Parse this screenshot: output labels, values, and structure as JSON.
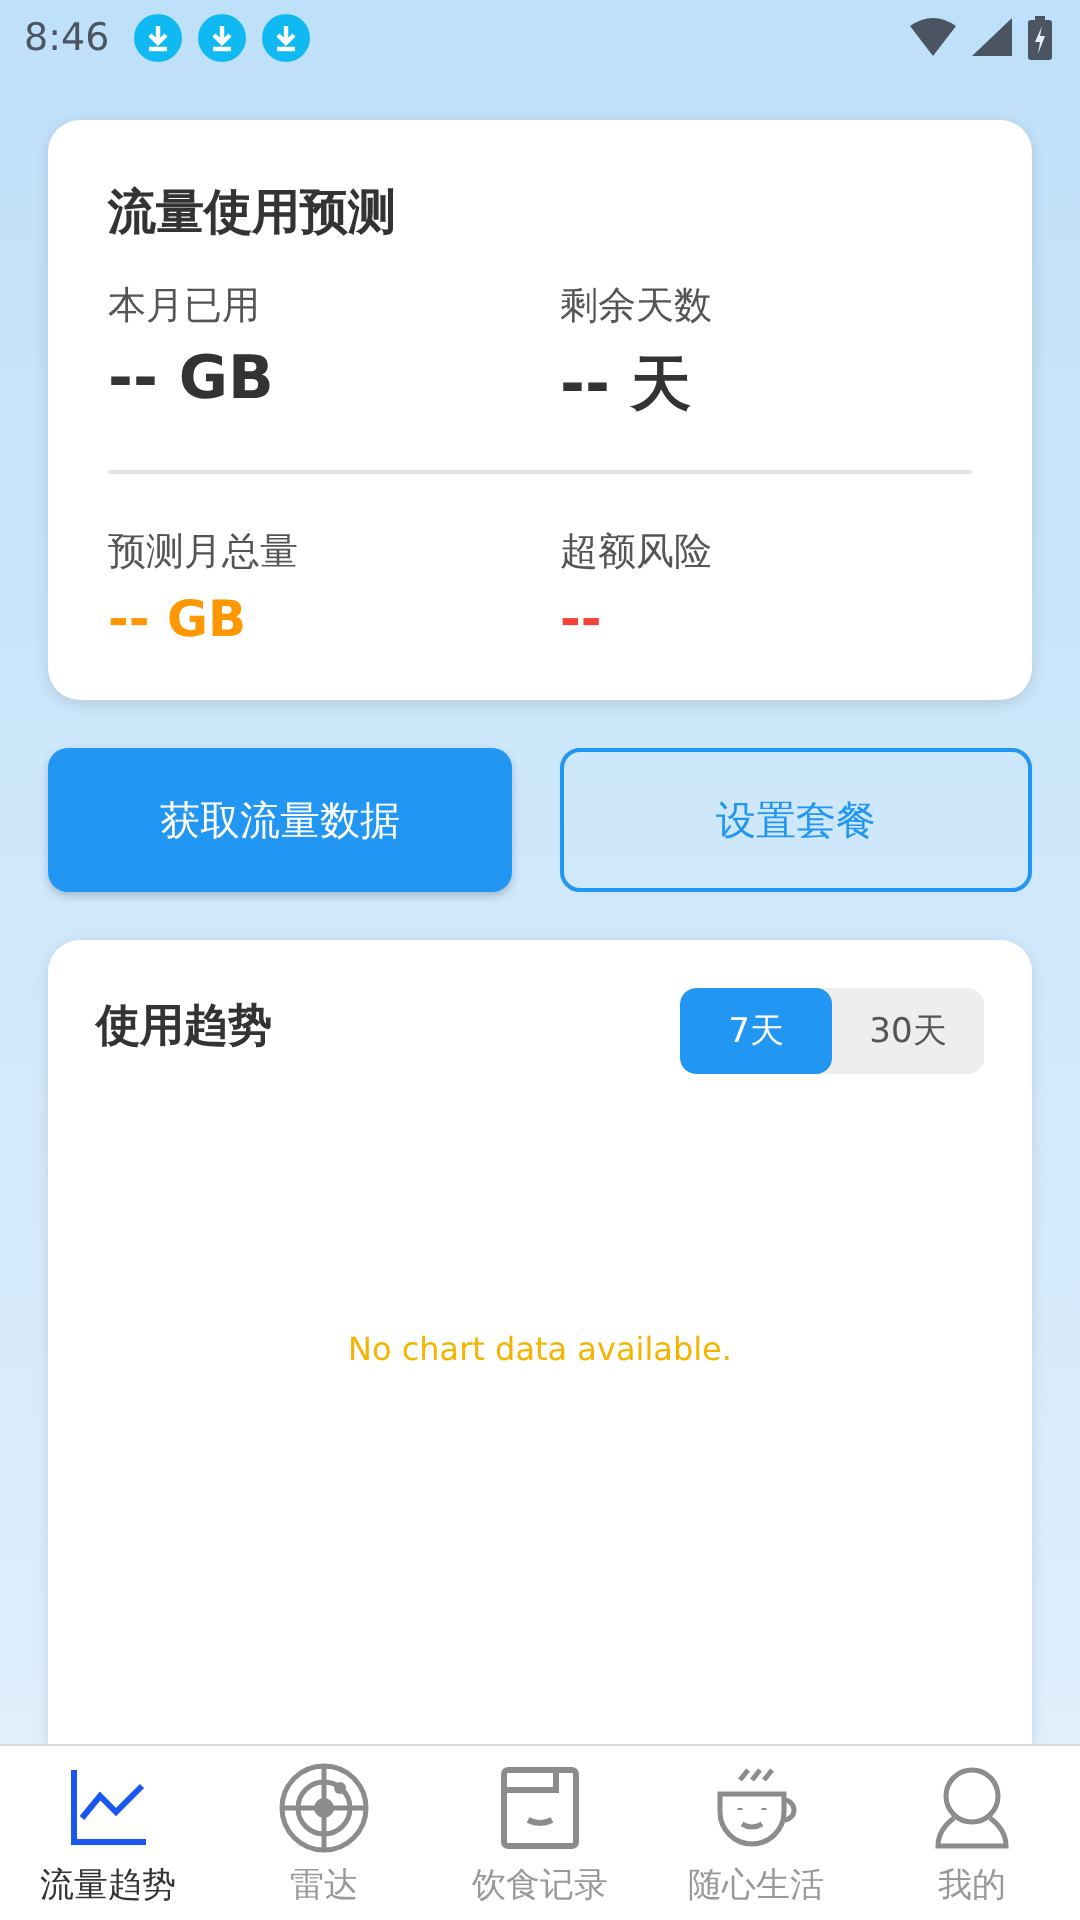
{
  "status_bar": {
    "time": "8:46",
    "notifications": [
      {
        "kind": "download"
      },
      {
        "kind": "download"
      },
      {
        "kind": "download"
      }
    ]
  },
  "forecast_card": {
    "title": "流量使用预测",
    "stats": [
      {
        "label": "本月已用",
        "value": "-- GB",
        "kind": "primary"
      },
      {
        "label": "剩余天数",
        "value": "-- 天",
        "kind": "primary"
      },
      {
        "label": "预测月总量",
        "value": "-- GB",
        "kind": "warning"
      },
      {
        "label": "超额风险",
        "value": "--",
        "kind": "danger"
      }
    ]
  },
  "actions": [
    {
      "label": "获取流量数据",
      "kind": "filled"
    },
    {
      "label": "设置套餐",
      "kind": "outlined"
    }
  ],
  "trend_card": {
    "title": "使用趋势",
    "ranges": [
      {
        "label": "7天",
        "selected": true
      },
      {
        "label": "30天",
        "selected": false
      }
    ],
    "empty_message": "No chart data available."
  },
  "bottom_nav": [
    {
      "label": "流量趋势",
      "kind": "chart",
      "selected": true
    },
    {
      "label": "雷达",
      "kind": "radar",
      "selected": false
    },
    {
      "label": "饮食记录",
      "kind": "box",
      "selected": false
    },
    {
      "label": "随心生活",
      "kind": "cup",
      "selected": false
    },
    {
      "label": "我的",
      "kind": "person",
      "selected": false
    }
  ]
}
